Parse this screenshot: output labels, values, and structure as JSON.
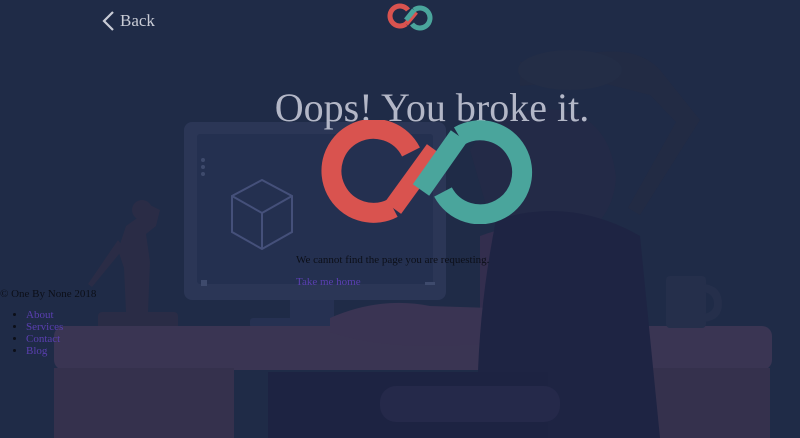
{
  "header": {
    "back_label": "Back"
  },
  "error": {
    "title": "Oops! You broke it.",
    "message": "We cannot find the page you are requesting.",
    "home_link": "Take me home"
  },
  "footer": {
    "copyright": "© One By None 2018",
    "links": [
      "About",
      "Services",
      "Contact",
      "Blog"
    ]
  },
  "colors": {
    "background": "#1f2b47",
    "logo_red": "#d9534f",
    "logo_teal": "#4aa59c",
    "link": "#5a3fb0"
  },
  "icons": {
    "back": "chevron-left-icon",
    "brand": "infinity-logo-icon"
  }
}
